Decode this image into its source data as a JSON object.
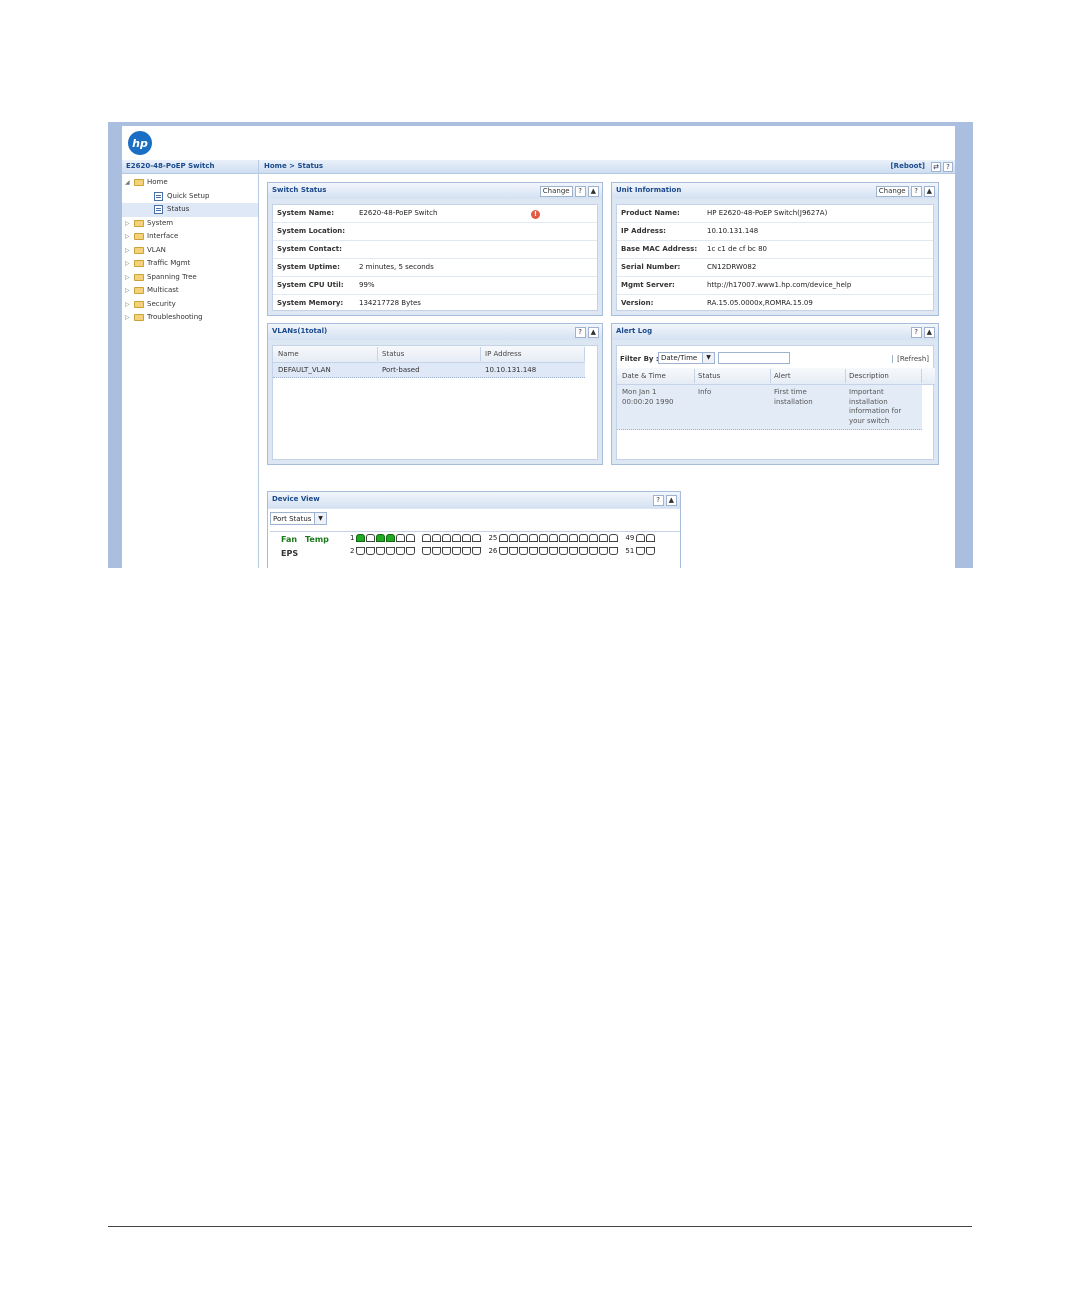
{
  "logo_text": "hp",
  "sidebar": {
    "title": "E2620-48-PoEP Switch",
    "items": [
      {
        "label": "Home",
        "type": "folder",
        "expanded": true,
        "level": 0
      },
      {
        "label": "Quick Setup",
        "type": "page",
        "level": 1
      },
      {
        "label": "Status",
        "type": "page",
        "level": 1,
        "selected": true
      },
      {
        "label": "System",
        "type": "folder",
        "level": 0
      },
      {
        "label": "Interface",
        "type": "folder",
        "level": 0
      },
      {
        "label": "VLAN",
        "type": "folder",
        "level": 0
      },
      {
        "label": "Traffic Mgmt",
        "type": "folder",
        "level": 0
      },
      {
        "label": "Spanning Tree",
        "type": "folder",
        "level": 0
      },
      {
        "label": "Multicast",
        "type": "folder",
        "level": 0
      },
      {
        "label": "Security",
        "type": "folder",
        "level": 0
      },
      {
        "label": "Troubleshooting",
        "type": "folder",
        "level": 0
      }
    ]
  },
  "header": {
    "breadcrumb": "Home > Status",
    "reboot_label": "[Reboot]",
    "refresh_icon": "⇄",
    "help_label": "?"
  },
  "switch_status": {
    "title": "Switch Status",
    "change_label": "Change",
    "help_label": "?",
    "collapse_label": "▲",
    "rows": [
      {
        "key": "System Name:",
        "value": "E2620-48-PoEP Switch"
      },
      {
        "key": "System Location:",
        "value": ""
      },
      {
        "key": "System Contact:",
        "value": ""
      },
      {
        "key": "System Uptime:",
        "value": "2 minutes, 5 seconds"
      },
      {
        "key": "System CPU Util:",
        "value": "99%"
      },
      {
        "key": "System Memory:",
        "value": "134217728 Bytes"
      }
    ],
    "alert_icon": "!"
  },
  "unit_info": {
    "title": "Unit Information",
    "change_label": "Change",
    "help_label": "?",
    "collapse_label": "▲",
    "rows": [
      {
        "key": "Product Name:",
        "value": "HP E2620-48-PoEP Switch(J9627A)"
      },
      {
        "key": "IP Address:",
        "value": "10.10.131.148"
      },
      {
        "key": "Base MAC Address:",
        "value": "1c c1 de cf bc 80"
      },
      {
        "key": "Serial Number:",
        "value": "CN12DRW082"
      },
      {
        "key": "Mgmt Server:",
        "value": "http://h17007.www1.hp.com/device_help"
      },
      {
        "key": "Version:",
        "value": "RA.15.05.0000x,ROMRA.15.09"
      }
    ]
  },
  "vlans": {
    "title": "VLANs(1total)",
    "help_label": "?",
    "collapse_label": "▲",
    "columns": [
      "Name",
      "Status",
      "IP Address"
    ],
    "rows": [
      {
        "name": "DEFAULT_VLAN",
        "status": "Port-based",
        "ip": "10.10.131.148"
      }
    ]
  },
  "alert_log": {
    "title": "Alert Log",
    "help_label": "?",
    "collapse_label": "▲",
    "filter_label": "Filter By :",
    "filter_value": "Date/Time",
    "filter_text": "",
    "refresh_label": "[Refresh]",
    "columns": [
      "Date & Time",
      "Status",
      "Alert",
      "Description"
    ],
    "rows": [
      {
        "date": "Mon Jan 1 00:00:20 1990",
        "status": "Info",
        "alert": "First time installation",
        "description": "Important installation information for your switch"
      }
    ]
  },
  "device_view": {
    "title": "Device View",
    "help_label": "?",
    "collapse_label": "▲",
    "select_value": "Port Status",
    "fan_label": "Fan",
    "temp_label": "Temp",
    "eps_label": "EPS",
    "top_port_labels": [
      "1",
      "25",
      "49"
    ],
    "bottom_port_labels": [
      "2",
      "26",
      "51"
    ],
    "ports_up_top": [
      1,
      3,
      4
    ]
  },
  "colors": {
    "accent": "#1b4a8c",
    "frame": "#aabfe0",
    "port_up": "#22aa22"
  }
}
